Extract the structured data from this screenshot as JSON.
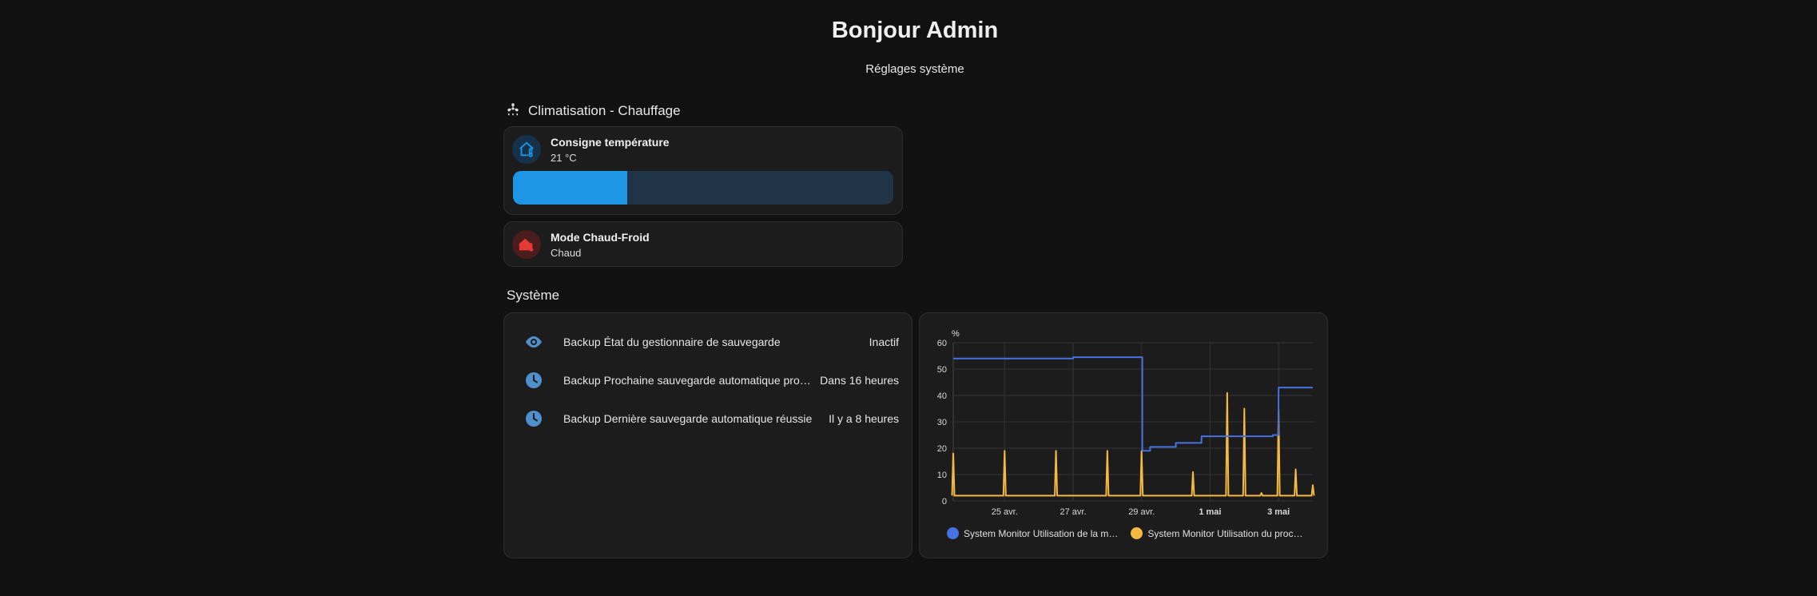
{
  "header": {
    "title": "Bonjour Admin",
    "subtitle": "Réglages système"
  },
  "climate": {
    "section_title": "Climatisation - Chauffage",
    "section_icon": "fan-heat-icon",
    "setpoint": {
      "name": "Consigne température",
      "state": "21 °C",
      "icon": "home-thermometer-icon",
      "fill_fraction": 0.3
    },
    "mode": {
      "name": "Mode Chaud-Froid",
      "state": "Chaud",
      "icon": "home-heat-icon"
    }
  },
  "system": {
    "section_title": "Système",
    "entities": [
      {
        "icon": "eye-icon",
        "name": "Backup État du gestionnaire de sauvegarde",
        "value": "Inactif"
      },
      {
        "icon": "clock-icon",
        "name": "Backup Prochaine sauvegarde automatique programmée",
        "value": "Dans 16 heures"
      },
      {
        "icon": "clock-icon",
        "name": "Backup Dernière sauvegarde automatique réussie",
        "value": "Il y a 8 heures"
      }
    ]
  },
  "colors": {
    "accent_blue": "#1f95e6",
    "memory_series": "#4472e0",
    "cpu_series": "#f5b942",
    "heat_red": "#e53935"
  },
  "chart_data": {
    "type": "line",
    "ylabel": "%",
    "ylim": [
      0,
      60
    ],
    "yticks": [
      0,
      10,
      20,
      30,
      40,
      50,
      60
    ],
    "x_range": [
      "2025-04-23T12:00",
      "2025-05-04T00:00"
    ],
    "xticks": [
      {
        "label": "25 avr.",
        "x": "2025-04-25",
        "bold": false
      },
      {
        "label": "27 avr.",
        "x": "2025-04-27",
        "bold": false
      },
      {
        "label": "29 avr.",
        "x": "2025-04-29",
        "bold": false
      },
      {
        "label": "1 mai",
        "x": "2025-05-01",
        "bold": true
      },
      {
        "label": "3 mai",
        "x": "2025-05-03",
        "bold": true
      }
    ],
    "grid": true,
    "legend": "bottom-left",
    "series": [
      {
        "name": "System Monitor Utilisation de la m…",
        "color": "#4472e0",
        "x": [
          "2025-04-23T12:00",
          "2025-04-25T00:00",
          "2025-04-27T00:00",
          "2025-04-29T00:00",
          "2025-04-29T00:30",
          "2025-04-29T06:00",
          "2025-04-30T00:00",
          "2025-04-30T12:00",
          "2025-04-30T18:00",
          "2025-05-01T12:00",
          "2025-05-02T12:00",
          "2025-05-02T20:00",
          "2025-05-03T00:00",
          "2025-05-04T00:00"
        ],
        "y": [
          54,
          54,
          54.5,
          54.5,
          19,
          20.5,
          22,
          22,
          24.5,
          24.5,
          24.5,
          25,
          43,
          43
        ]
      },
      {
        "name": "System Monitor Utilisation du proc…",
        "color": "#f5b942",
        "x": [
          "2025-04-23T12:00",
          "2025-04-24T00:00",
          "2025-04-24T12:00",
          "2025-04-25T00:00",
          "2025-04-25T12:00",
          "2025-04-26T00:00",
          "2025-04-26T12:00",
          "2025-04-27T00:00",
          "2025-04-27T12:00",
          "2025-04-28T00:00",
          "2025-04-28T12:00",
          "2025-04-29T00:00",
          "2025-04-29T12:00",
          "2025-04-30T00:00",
          "2025-04-30T12:00",
          "2025-05-01T00:00",
          "2025-05-01T12:00",
          "2025-05-02T00:00",
          "2025-05-02T12:00",
          "2025-05-03T00:00",
          "2025-05-03T12:00",
          "2025-05-04T00:00"
        ],
        "y": [
          18,
          2,
          2,
          19,
          2,
          2,
          19,
          2,
          2,
          19,
          2,
          19,
          2,
          2,
          11,
          2,
          41,
          35,
          3,
          34,
          12,
          6
        ]
      }
    ]
  }
}
